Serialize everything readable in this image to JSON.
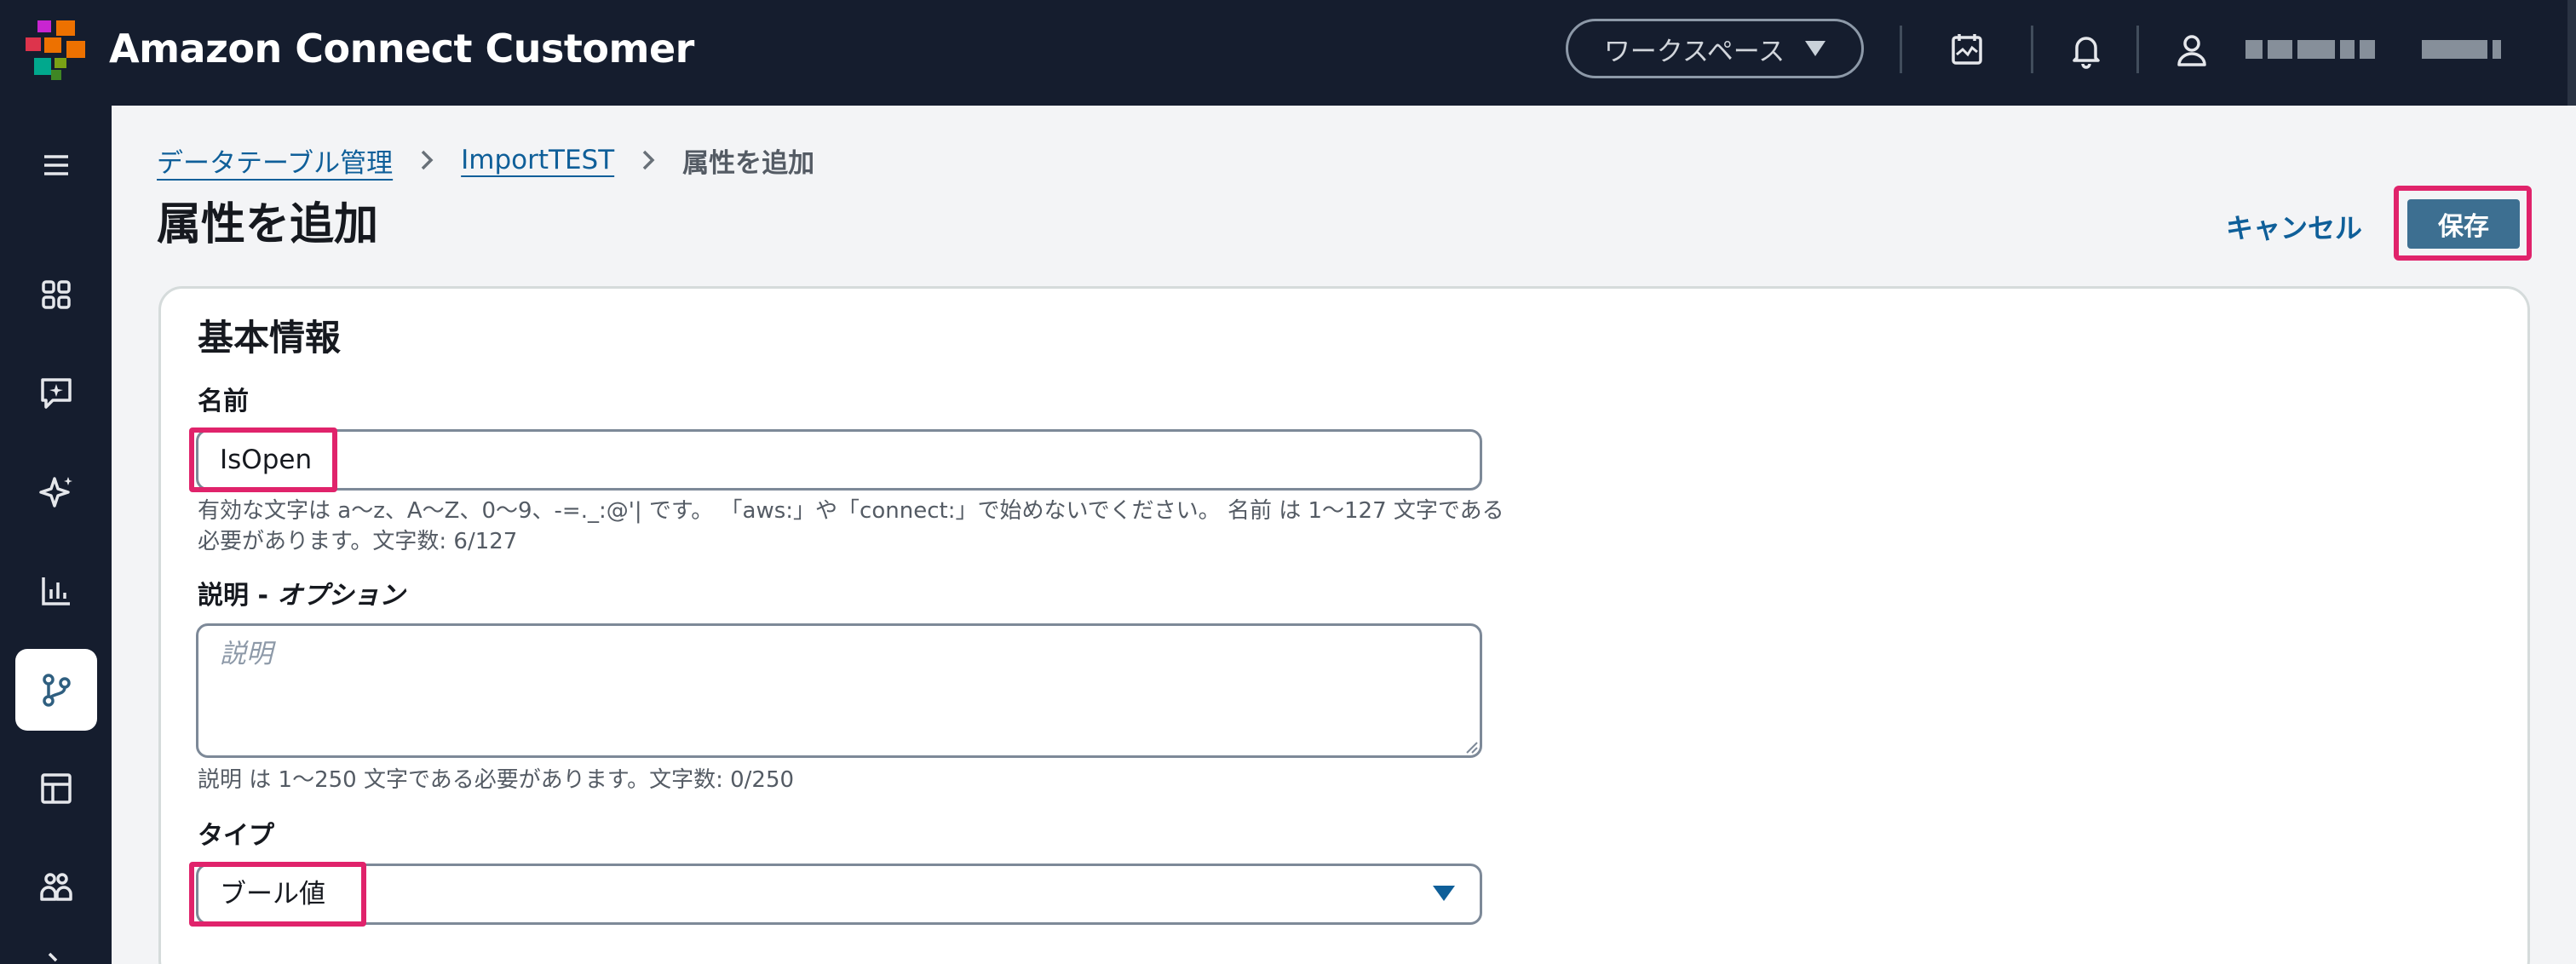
{
  "header": {
    "app_title": "Amazon Connect Customer",
    "workspace_label": "ワークスペース"
  },
  "sidebar": {
    "items": [
      {
        "icon": "menu-icon"
      },
      {
        "icon": "dashboard-grid-icon"
      },
      {
        "icon": "chat-sparkle-icon"
      },
      {
        "icon": "ai-sparkle-icon"
      },
      {
        "icon": "analytics-bar-chart-icon"
      },
      {
        "icon": "routing-flow-icon",
        "active": true
      },
      {
        "icon": "layout-panel-icon"
      },
      {
        "icon": "users-group-icon"
      }
    ]
  },
  "breadcrumb": {
    "items": [
      "データテーブル管理",
      "ImportTEST"
    ],
    "current": "属性を追加"
  },
  "page": {
    "title": "属性を追加",
    "cancel_label": "キャンセル",
    "save_label": "保存"
  },
  "form": {
    "section_title": "基本情報",
    "name": {
      "label": "名前",
      "value": "IsOpen",
      "hint_line1": "有効な文字は a〜z、A〜Z、0〜9、-=._:@'| です。 「aws:」や「connect:」で始めないでください。 名前 は 1〜127 文字である",
      "hint_line2": "必要があります。文字数: 6/127"
    },
    "description": {
      "label": "説明 - ",
      "label_optional": "オプション",
      "placeholder": "説明",
      "hint": "説明 は 1〜250 文字である必要があります。文字数: 0/250"
    },
    "type": {
      "label": "タイプ",
      "value": "ブール値"
    }
  },
  "colors": {
    "topbar_bg": "#151d2e",
    "link": "#0f5f99",
    "primary_button": "#3d6f91",
    "highlight": "#e0236b"
  }
}
